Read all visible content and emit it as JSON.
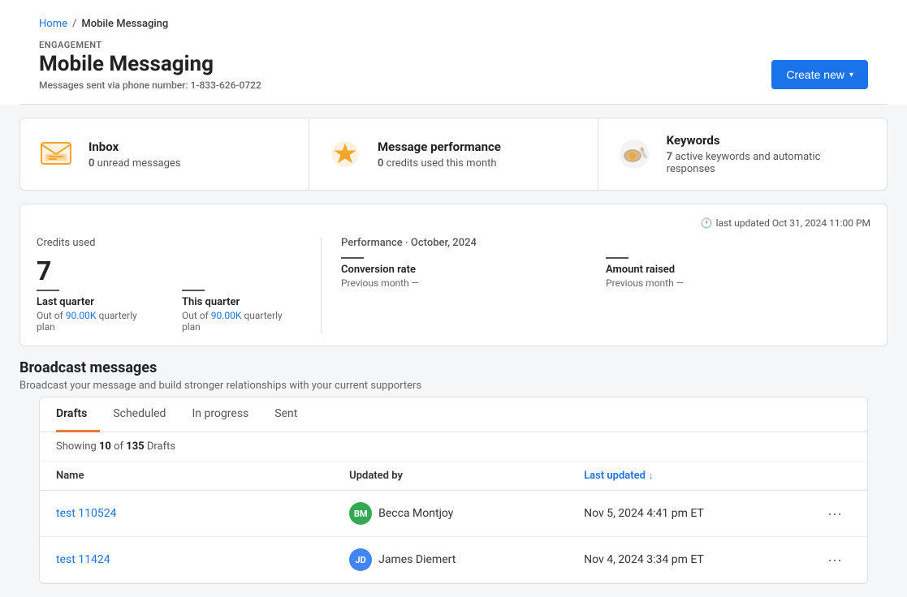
{
  "breadcrumb": {
    "home": "Home",
    "separator": "/",
    "current": "Mobile Messaging"
  },
  "header": {
    "engagement_label": "ENGAGEMENT",
    "title": "Mobile Messaging",
    "subtitle_prefix": "Messages sent via phone number:",
    "phone_number": "1-833-626-0722",
    "create_button": "Create new"
  },
  "stats": [
    {
      "id": "inbox",
      "icon": "💬",
      "title": "Inbox",
      "value": "0",
      "value_label": "unread messages"
    },
    {
      "id": "message_performance",
      "icon": "⭐",
      "title": "Message performance",
      "value": "0",
      "value_label": "credits used this month"
    },
    {
      "id": "keywords",
      "icon": "🔑",
      "title": "Keywords",
      "value": "7",
      "value_label": "active keywords and automatic responses"
    }
  ],
  "performance": {
    "last_updated_label": "last updated Oct 31, 2024 11:00 PM",
    "credits_used_label": "Credits used",
    "credits_value": "7",
    "last_quarter_line": "—",
    "last_quarter_title": "Last quarter",
    "last_quarter_sub_prefix": "Out of",
    "last_quarter_plan": "90.00K",
    "last_quarter_sub_suffix": "quarterly plan",
    "this_quarter_line": "—",
    "this_quarter_title": "This quarter",
    "this_quarter_sub_prefix": "Out of",
    "this_quarter_plan": "90.00K",
    "this_quarter_sub_suffix": "quarterly plan",
    "perf_label": "Performance · October, 2024",
    "conversion_rate_line": "—",
    "conversion_rate_title": "Conversion rate",
    "conversion_rate_sub": "Previous month —",
    "amount_raised_line": "—",
    "amount_raised_title": "Amount raised",
    "amount_raised_sub": "Previous month —"
  },
  "broadcast": {
    "title": "Broadcast messages",
    "subtitle": "Broadcast your message and build stronger relationships with your current supporters",
    "tabs": [
      {
        "id": "drafts",
        "label": "Drafts",
        "active": true
      },
      {
        "id": "scheduled",
        "label": "Scheduled",
        "active": false
      },
      {
        "id": "in_progress",
        "label": "In progress",
        "active": false
      },
      {
        "id": "sent",
        "label": "Sent",
        "active": false
      }
    ],
    "showing": {
      "count": "10",
      "total": "135",
      "type": "Drafts"
    },
    "columns": {
      "name": "Name",
      "updated_by": "Updated by",
      "last_updated": "Last updated",
      "sort_arrow": "↓"
    },
    "rows": [
      {
        "id": "row1",
        "name": "test 110524",
        "updated_by_initials": "BM",
        "updated_by_name": "Becca Montjoy",
        "avatar_color": "green",
        "last_updated": "Nov 5, 2024 4:41 pm ET"
      },
      {
        "id": "row2",
        "name": "test 11424",
        "updated_by_initials": "JD",
        "updated_by_name": "James Diemert",
        "avatar_color": "blue",
        "last_updated": "Nov 4, 2024 3:34 pm ET"
      }
    ]
  }
}
